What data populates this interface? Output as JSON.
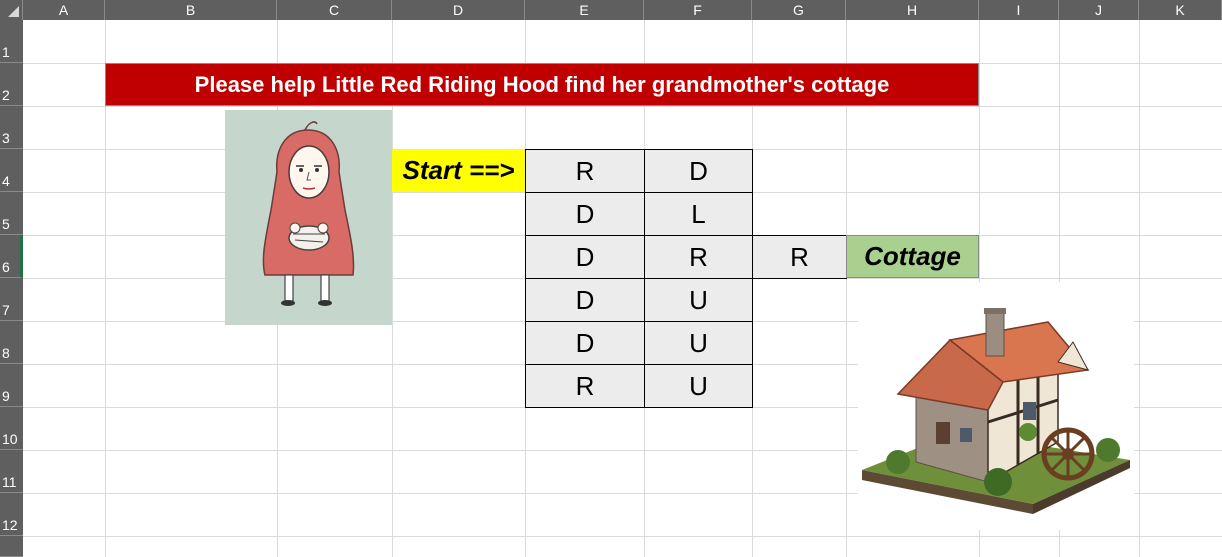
{
  "spreadsheet": {
    "column_headers": [
      "A",
      "B",
      "C",
      "D",
      "E",
      "F",
      "G",
      "H",
      "I",
      "J",
      "K"
    ],
    "row_headers": [
      "1",
      "2",
      "3",
      "4",
      "5",
      "6",
      "7",
      "8",
      "9",
      "10",
      "11",
      "12"
    ],
    "selected_row": "6"
  },
  "content": {
    "title": "Please help Little Red Riding Hood find her grandmother's cottage",
    "start_label": "Start ==>",
    "destination_label": "Cottage",
    "maze": {
      "row4": {
        "E": "R",
        "F": "D"
      },
      "row5": {
        "E": "D",
        "F": "L"
      },
      "row6": {
        "E": "D",
        "F": "R",
        "G": "R"
      },
      "row7": {
        "E": "D",
        "F": "U"
      },
      "row8": {
        "E": "D",
        "F": "U"
      },
      "row9": {
        "E": "R",
        "F": "U"
      }
    }
  },
  "colors": {
    "title_background": "#c00000",
    "start_background": "#ffff00",
    "cottage_background": "#a9d08e",
    "maze_background": "#ececec",
    "header_background": "#5f5f5f"
  },
  "icons": [
    "little-red-riding-hood-image",
    "cottage-image"
  ]
}
